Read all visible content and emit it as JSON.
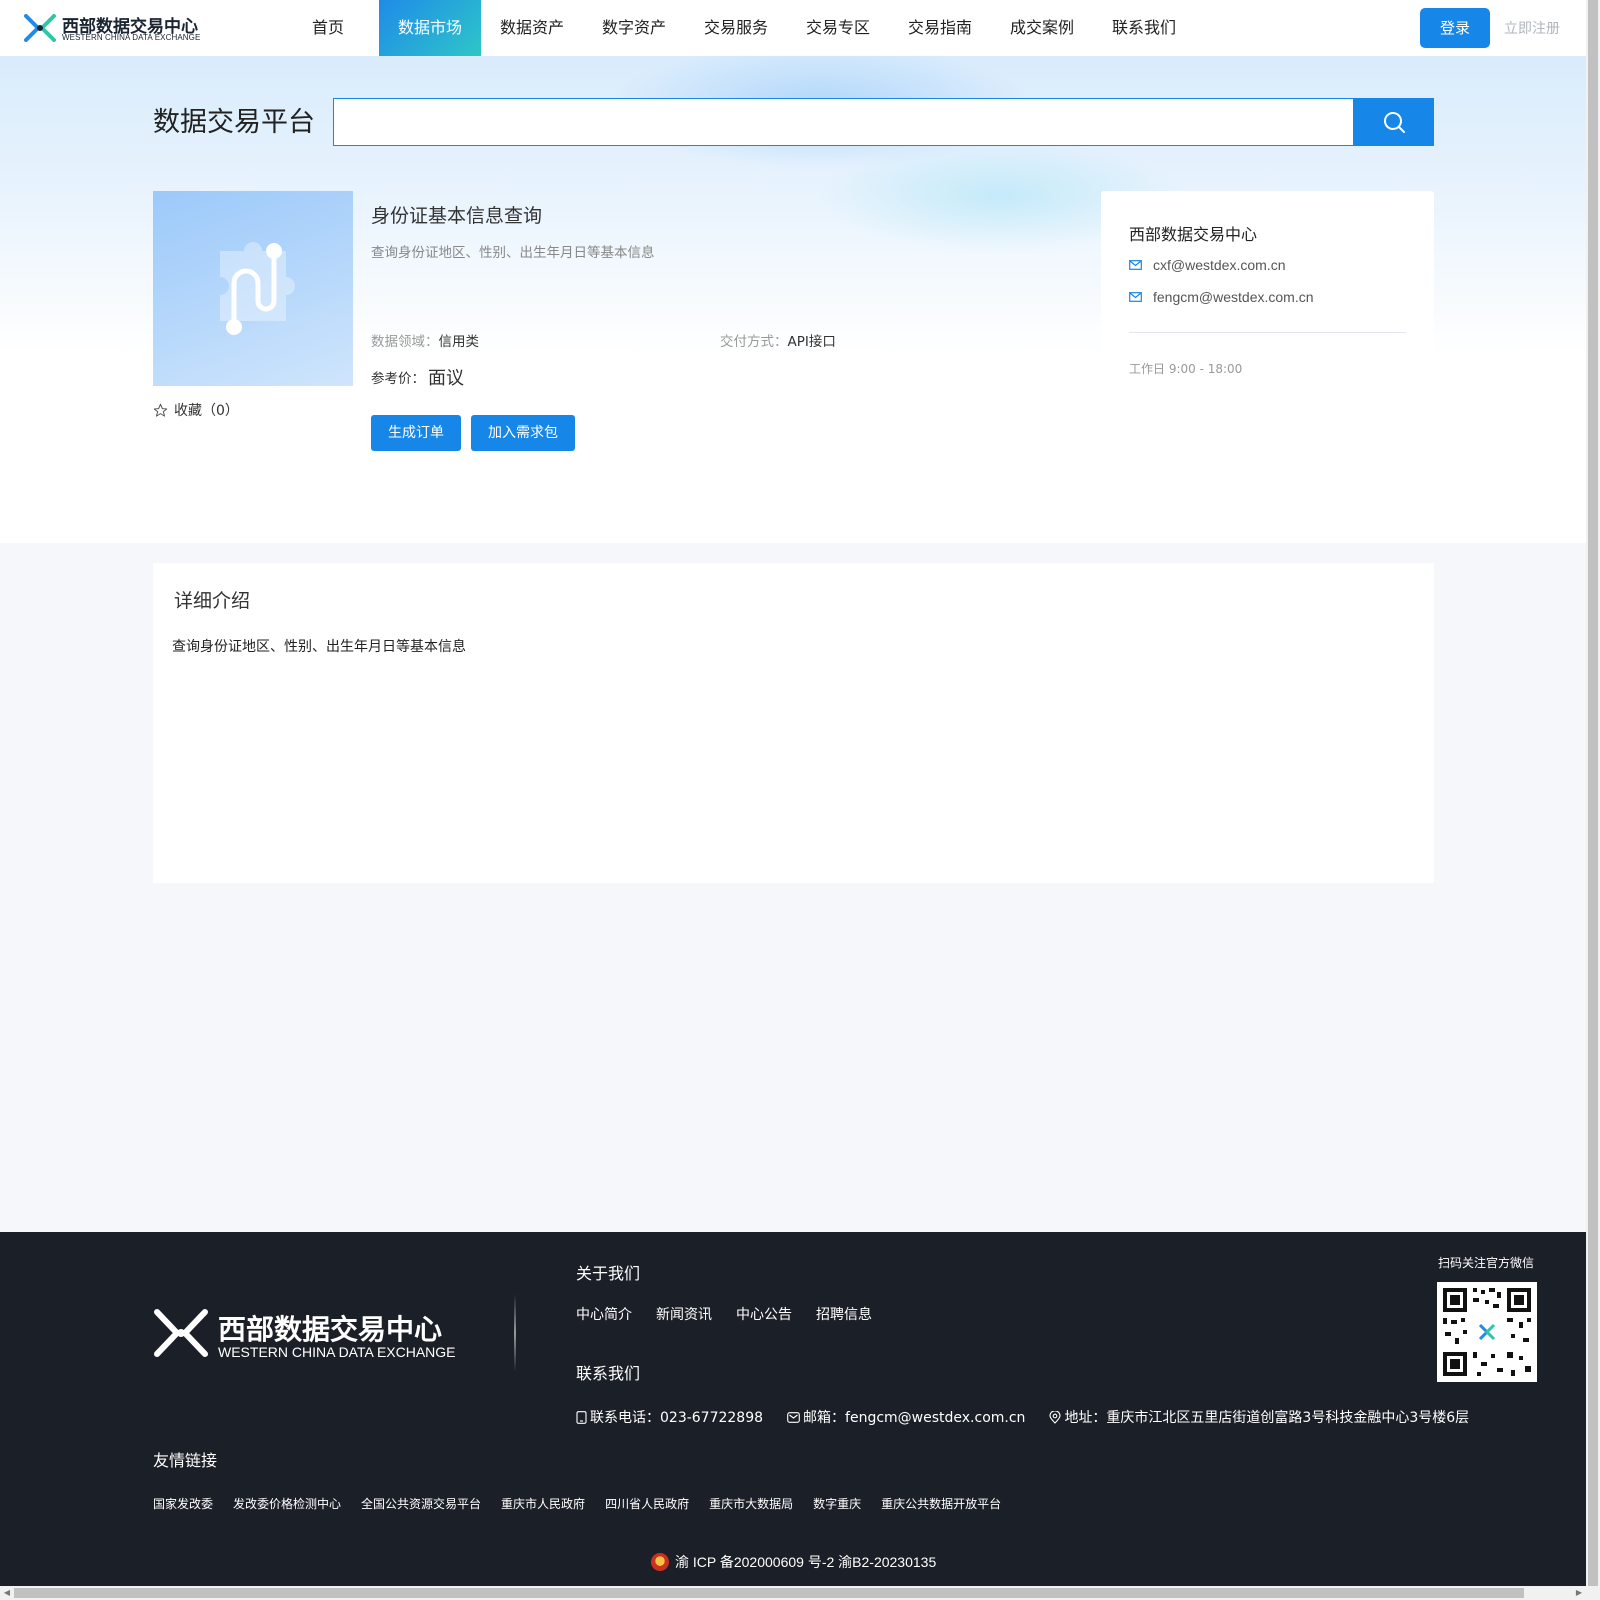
{
  "header": {
    "logo_cn": "西部数据交易中心",
    "logo_en": "WESTERN CHINA DATA EXCHANGE",
    "nav": [
      {
        "label": "首页",
        "active": false
      },
      {
        "label": "数据市场",
        "active": true
      },
      {
        "label": "数据资产",
        "active": false
      },
      {
        "label": "数字资产",
        "active": false
      },
      {
        "label": "交易服务",
        "active": false
      },
      {
        "label": "交易专区",
        "active": false
      },
      {
        "label": "交易指南",
        "active": false
      },
      {
        "label": "成交案例",
        "active": false
      },
      {
        "label": "联系我们",
        "active": false
      }
    ],
    "login_label": "登录",
    "register_label": "立即注册"
  },
  "search": {
    "title": "数据交易平台",
    "value": "",
    "icon": "search-icon"
  },
  "product": {
    "title": "身份证基本信息查询",
    "subtitle": "查询身份证地区、性别、出生年月日等基本信息",
    "domain_label": "数据领域：",
    "domain_value": "信用类",
    "delivery_label": "交付方式：",
    "delivery_value": "API接口",
    "price_label": "参考价：",
    "price_value": "面议",
    "favorite_label": "收藏（0）",
    "order_button": "生成订单",
    "cart_button": "加入需求包"
  },
  "contact": {
    "org": "西部数据交易中心",
    "emails": [
      "cxf@westdex.com.cn",
      "fengcm@westdex.com.cn"
    ],
    "hours": "工作日 9:00 - 18:00"
  },
  "details": {
    "title": "详细介绍",
    "body": "查询身份证地区、性别、出生年月日等基本信息"
  },
  "footer": {
    "logo_cn": "西部数据交易中心",
    "logo_en": "WESTERN CHINA DATA EXCHANGE",
    "about_title": "关于我们",
    "about_links": [
      "中心简介",
      "新闻资讯",
      "中心公告",
      "招聘信息"
    ],
    "contact_title": "联系我们",
    "phone": "联系电话：023-67722898",
    "email": "邮箱：fengcm@westdex.com.cn",
    "address": "地址：重庆市江北区五里店街道创富路3号科技金融中心3号楼6层",
    "qr_label": "扫码关注官方微信",
    "friend_title": "友情链接",
    "friend_links": [
      "国家发改委",
      "发改委价格检测中心",
      "全国公共资源交易平台",
      "重庆市人民政府",
      "四川省人民政府",
      "重庆市大数据局",
      "数字重庆",
      "重庆公共数据开放平台"
    ],
    "icp": "渝 ICP 备202000609 号-2 渝B2-20230135"
  },
  "colors": {
    "primary": "#1687e8",
    "footer_bg": "#1b1f27",
    "nav_active_start": "#1f8be8",
    "nav_active_end": "#2ec6c8"
  }
}
